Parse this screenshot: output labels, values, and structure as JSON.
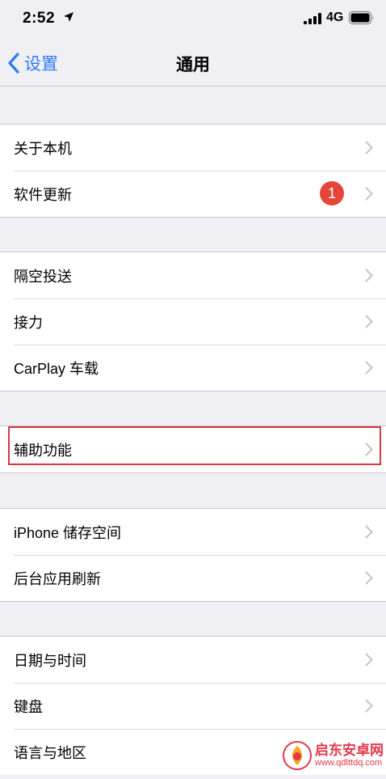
{
  "status_bar": {
    "time": "2:52",
    "network": "4G",
    "icons": [
      "location-arrow-icon",
      "signal-bars-icon",
      "battery-icon"
    ]
  },
  "nav": {
    "back_label": "设置",
    "title": "通用"
  },
  "groups": [
    {
      "rows": [
        {
          "label": "关于本机"
        },
        {
          "label": "软件更新",
          "badge": "1"
        }
      ]
    },
    {
      "rows": [
        {
          "label": "隔空投送"
        },
        {
          "label": "接力"
        },
        {
          "label": "CarPlay 车载"
        }
      ]
    },
    {
      "rows": [
        {
          "label": "辅助功能",
          "highlighted": true
        }
      ]
    },
    {
      "rows": [
        {
          "label": "iPhone 储存空间"
        },
        {
          "label": "后台应用刷新"
        }
      ]
    },
    {
      "rows": [
        {
          "label": "日期与时间"
        },
        {
          "label": "键盘"
        },
        {
          "label": "语言与地区"
        }
      ]
    }
  ],
  "watermark": {
    "name": "启东安卓网",
    "url": "www.qdlttdq.com"
  },
  "colors": {
    "background": "#efeff4",
    "accent": "#2f7cf6",
    "badge": "#e5463a",
    "highlight_box": "#d9363e"
  }
}
